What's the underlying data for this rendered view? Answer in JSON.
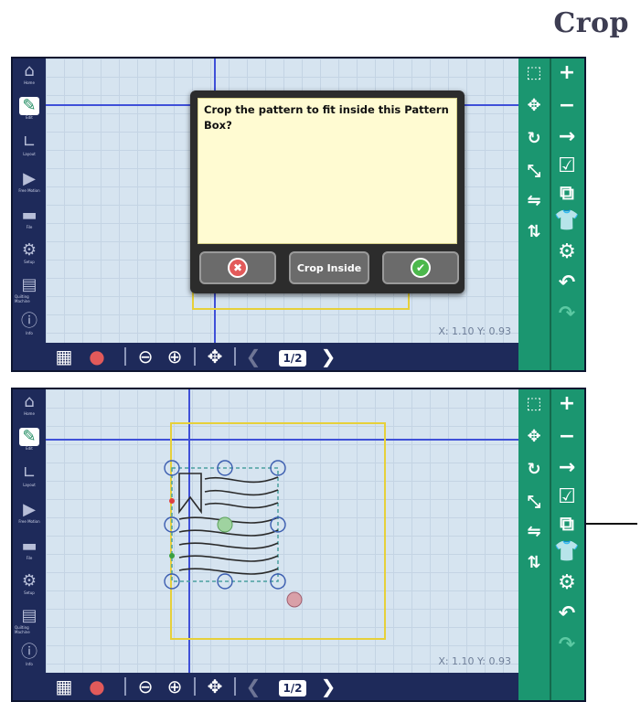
{
  "page": {
    "heading": "Crop"
  },
  "left_sidebar": [
    {
      "label": "Home",
      "icon": "home-icon",
      "glyph": "⌂"
    },
    {
      "label": "Edit",
      "icon": "edit-icon",
      "glyph": "✎",
      "active": true
    },
    {
      "label": "Layout",
      "icon": "layout-icon",
      "glyph": "∟"
    },
    {
      "label": "Free Motion",
      "icon": "free-motion-icon",
      "glyph": "▶"
    },
    {
      "label": "File",
      "icon": "folder-icon",
      "glyph": "▬"
    },
    {
      "label": "Setup",
      "icon": "gears-icon",
      "glyph": "⚙"
    },
    {
      "label": "Quilting Machine",
      "icon": "quilting-machine-icon",
      "glyph": "▤"
    },
    {
      "label": "Info",
      "icon": "info-icon",
      "glyph": "ⓘ"
    }
  ],
  "right_toolbar": {
    "col1": [
      {
        "icon": "pattern-box-icon",
        "glyph": "⬚"
      },
      {
        "icon": "move-pattern-icon",
        "glyph": "✥"
      },
      {
        "icon": "rotate-icon",
        "glyph": "↻"
      },
      {
        "icon": "resize-icon",
        "glyph": "⤡"
      },
      {
        "icon": "mirror-icon",
        "glyph": "⇋"
      },
      {
        "icon": "flip-icon",
        "glyph": "⇅"
      }
    ],
    "col2": [
      {
        "icon": "add-icon",
        "glyph": "+"
      },
      {
        "icon": "remove-icon",
        "glyph": "−"
      },
      {
        "icon": "next-arrow-icon",
        "glyph": "→"
      },
      {
        "icon": "edit-list-icon",
        "glyph": "☑"
      },
      {
        "icon": "crop-icon",
        "glyph": "⧉"
      },
      {
        "icon": "shirt-icon",
        "glyph": "👕"
      },
      {
        "icon": "settings-gear-icon",
        "glyph": "⚙"
      },
      {
        "icon": "undo-icon",
        "glyph": "↶"
      },
      {
        "icon": "redo-icon",
        "glyph": "↷",
        "faded": true
      }
    ]
  },
  "bottom_toolbar": {
    "grid_icon": "▦",
    "needle_icon": "●",
    "zoom_out_icon": "⊖",
    "zoom_in_icon": "⊕",
    "pan_icon": "✥",
    "prev_icon": "❮",
    "page_indicator": "1/2",
    "next_icon": "❯"
  },
  "coordinates": {
    "text": "X: 1.10  Y: 0.93"
  },
  "dialog": {
    "message": "Crop the pattern to fit inside this Pattern Box?",
    "cancel_glyph": "✖",
    "crop_inside_label": "Crop Inside",
    "confirm_glyph": "✔"
  },
  "colors": {
    "sidebar": "#1e2a5a",
    "toolbar_green": "#1b9670",
    "guide_blue": "#3f50d8",
    "pattern_box": "#e6d03a",
    "dialog_bg": "#fffbd2"
  }
}
